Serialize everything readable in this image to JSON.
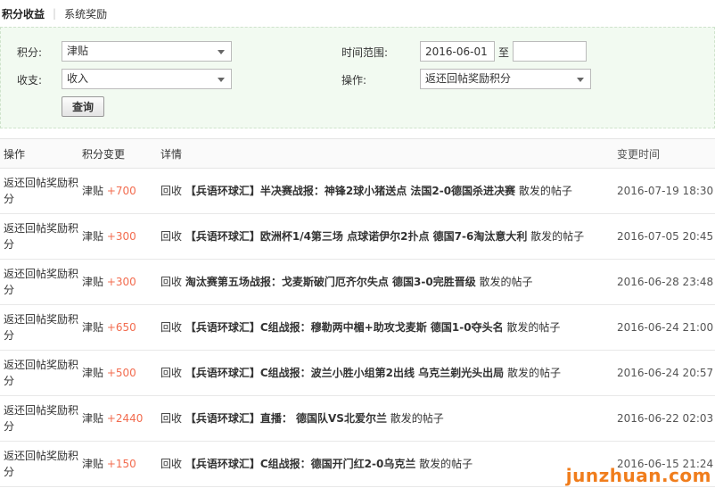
{
  "tabs": [
    {
      "label": "积分收益",
      "active": true
    },
    {
      "label": "系统奖励",
      "active": false
    }
  ],
  "filter": {
    "points_label": "积分:",
    "points_value": "津贴",
    "income_label": "收支:",
    "income_value": "收入",
    "time_label": "时间范围:",
    "date_from": "2016-06-01",
    "date_to_sep": "至",
    "date_to": "",
    "op_label": "操作:",
    "op_value": "返还回帖奖励积分",
    "query_label": "查询"
  },
  "table": {
    "headers": [
      "操作",
      "积分变更",
      "详情",
      "变更时间"
    ],
    "rows": [
      {
        "op": "返还回帖奖励积分",
        "type": "津贴",
        "pts": "+700",
        "prefix": "回收",
        "title": "【兵语环球汇】半决赛战报：神锋2球小猪送点 法国2-0德国杀进决赛",
        "suffix": "散发的帖子",
        "time": "2016-07-19 18:30"
      },
      {
        "op": "返还回帖奖励积分",
        "type": "津贴",
        "pts": "+300",
        "prefix": "回收",
        "title": "【兵语环球汇】欧洲杯1/4第三场 点球诺伊尔2扑点 德国7-6淘汰意大利",
        "suffix": "散发的帖子",
        "time": "2016-07-05 20:45"
      },
      {
        "op": "返还回帖奖励积分",
        "type": "津贴",
        "pts": "+300",
        "prefix": "回收",
        "title": "淘汰赛第五场战报：戈麦斯破门厄齐尔失点 德国3-0完胜晋级",
        "suffix": "散发的帖子",
        "time": "2016-06-28 23:48"
      },
      {
        "op": "返还回帖奖励积分",
        "type": "津贴",
        "pts": "+650",
        "prefix": "回收",
        "title": "【兵语环球汇】C组战报：穆勒两中楣+助攻戈麦斯 德国1-0夺头名",
        "suffix": "散发的帖子",
        "time": "2016-06-24 21:00"
      },
      {
        "op": "返还回帖奖励积分",
        "type": "津贴",
        "pts": "+500",
        "prefix": "回收",
        "title": "【兵语环球汇】C组战报：波兰小胜小组第2出线 乌克兰剃光头出局",
        "suffix": "散发的帖子",
        "time": "2016-06-24 20:57"
      },
      {
        "op": "返还回帖奖励积分",
        "type": "津贴",
        "pts": "+2440",
        "prefix": "回收",
        "title": "【兵语环球汇】直播： 德国队VS北爱尔兰",
        "suffix": "散发的帖子",
        "time": "2016-06-22 02:03"
      },
      {
        "op": "返还回帖奖励积分",
        "type": "津贴",
        "pts": "+150",
        "prefix": "回收",
        "title": "【兵语环球汇】C组战报：德国开门红2-0乌克兰",
        "suffix": "散发的帖子",
        "time": "2016-06-15 21:24"
      }
    ]
  },
  "watermark": "junzhuan.com",
  "colors": {
    "points": "#f26c4f",
    "filter_bg": "#f2faf1",
    "watermark": "#f07d1c"
  }
}
